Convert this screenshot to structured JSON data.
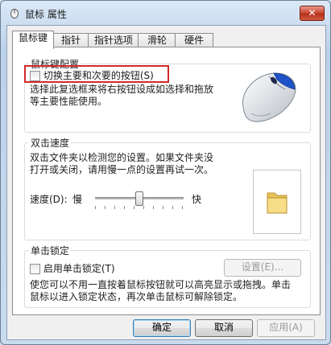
{
  "window": {
    "title": "鼠标 属性",
    "close_label": "✕"
  },
  "tabs": [
    {
      "label": "鼠标键",
      "active": true
    },
    {
      "label": "指针",
      "active": false
    },
    {
      "label": "指针选项",
      "active": false
    },
    {
      "label": "滑轮",
      "active": false
    },
    {
      "label": "硬件",
      "active": false
    }
  ],
  "button_config": {
    "legend": "鼠标键配置",
    "checkbox_label": "切换主要和次要的按钮(S)",
    "checked": false,
    "description_line1": "选择此复选框来将右按钮设成如选择和拖放",
    "description_line2": "等主要性能使用。",
    "image": "mouse-image"
  },
  "double_click": {
    "legend": "双击速度",
    "description_line1": "双击文件夹以检测您的设置。如果文件夹没",
    "description_line2": "打开或关闭，请用慢一点的设置再试一次。",
    "speed_label": "速度(D):",
    "slow_label": "慢",
    "fast_label": "快",
    "speed_level": 0.5,
    "icon": "folder-icon"
  },
  "click_lock": {
    "legend": "单击锁定",
    "checkbox_label": "启用单击锁定(T)",
    "checked": false,
    "settings_label": "设置(E)...",
    "description_line1": "使您可以不用一直按着鼠标按钮就可以高亮显示或拖拽。单击",
    "description_line2": "鼠标以进入锁定状态，再次单击鼠标可解除锁定。"
  },
  "footer": {
    "ok_label": "确定",
    "cancel_label": "取消",
    "apply_label": "应用(A)"
  },
  "colors": {
    "highlight": "#d12a2a",
    "close_button": "#c7452f"
  }
}
